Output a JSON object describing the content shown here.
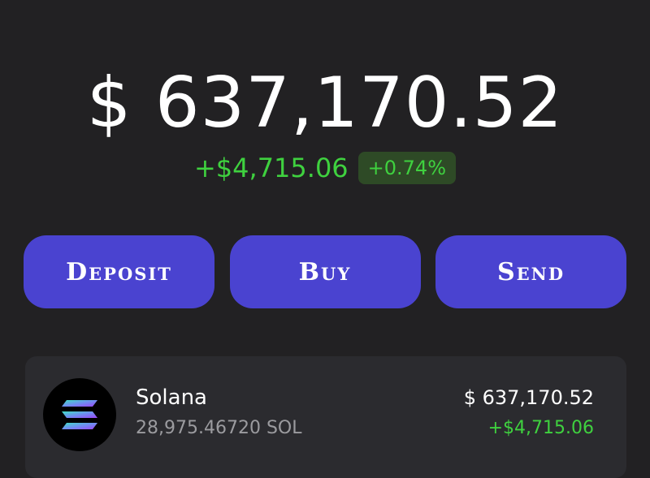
{
  "portfolio": {
    "balance": "$ 637,170.52",
    "change_amount": "+$4,715.06",
    "change_percent": "+0.74%"
  },
  "actions": {
    "deposit_label": "Deposit",
    "buy_label": "Buy",
    "send_label": "Send"
  },
  "assets": [
    {
      "name": "Solana",
      "amount": "28,975.46720 SOL",
      "value": "$ 637,170.52",
      "change": "+$4,715.06",
      "icon": "solana-logo-icon"
    }
  ],
  "colors": {
    "background": "#222123",
    "accent": "#4a43d0",
    "positive": "#3fd13f",
    "positive_pill_bg": "#2e4a26",
    "card": "#2b2b2f",
    "secondary_text": "#9b9b9f"
  }
}
